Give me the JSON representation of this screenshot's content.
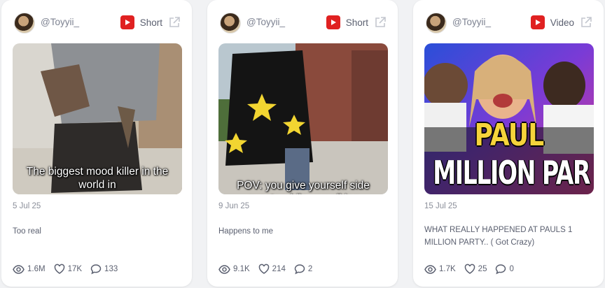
{
  "posts": [
    {
      "handle": "@Toyyii_",
      "type": "Short",
      "caption": "The biggest mood killer in the world in",
      "date": "5 Jul 25",
      "description": "Too real",
      "views": "1.6M",
      "likes": "17K",
      "comments": "133"
    },
    {
      "handle": "@Toyyii_",
      "type": "Short",
      "caption": "POV: you give yourself side quests while ur walking",
      "date": "9 Jun 25",
      "description": "Happens to me",
      "views": "9.1K",
      "likes": "214",
      "comments": "2"
    },
    {
      "handle": "@Toyyii_",
      "type": "Video",
      "thumb_text_line1": "PAUL",
      "thumb_text_line2": "MILLION PAR",
      "date": "15 Jul 25",
      "description": "WHAT REALLY HAPPENED AT PAULS 1 MILLION PARTY.. ( Got Crazy)",
      "views": "1.7K",
      "likes": "25",
      "comments": "0"
    }
  ],
  "colors": {
    "youtube_red": "#e02121",
    "page_bg": "#f1f2f4",
    "muted_text": "#5b6070"
  },
  "icons": [
    "youtube-icon",
    "external-link-icon",
    "eye-icon",
    "heart-icon",
    "comment-icon"
  ]
}
